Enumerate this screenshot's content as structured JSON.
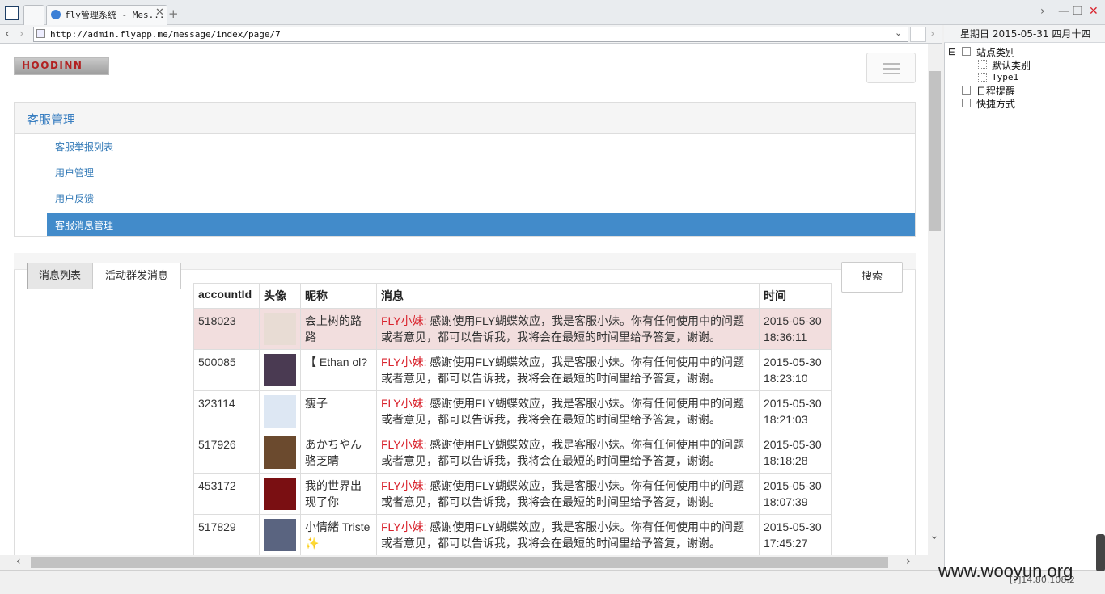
{
  "browser": {
    "tab_title": "fly管理系统 - Mes...",
    "new_tab": "+",
    "url": "http://admin.flyapp.me/message/index/page/7",
    "date": "星期日 2015-05-31 四月十四"
  },
  "side_tree": {
    "items": [
      {
        "label": "站点类别",
        "expand": "⊟"
      },
      {
        "label": "默认类别"
      },
      {
        "label": "Type1"
      },
      {
        "label": "日程提醒"
      },
      {
        "label": "快捷方式"
      }
    ]
  },
  "header": {
    "logo": "HOODINN"
  },
  "service_panel": {
    "title": "客服管理",
    "menu": [
      "客服举报列表",
      "用户管理",
      "用户反馈",
      "客服消息管理"
    ]
  },
  "messages": {
    "tabs": [
      "消息列表",
      "活动群发消息"
    ],
    "search_label": "搜索",
    "columns": [
      "accountId",
      "头像",
      "昵称",
      "消息",
      "时间"
    ],
    "sender": "FLY小妹:",
    "rows": [
      {
        "id": "518023",
        "nick": "会上树的路路",
        "text": " 感谢使用FLY蝴蝶效应，我是客服小妹。你有任何使用中的问题或者意见，都可以告诉我，我将会在最短的时间里给予答复，谢谢。",
        "time": "2015-05-30 18:36:11",
        "avatar_color": "#e8dcd4"
      },
      {
        "id": "500085",
        "nick": "【 Ethan ol?",
        "text": " 感谢使用FLY蝴蝶效应，我是客服小妹。你有任何使用中的问题或者意见，都可以告诉我，我将会在最短的时间里给予答复，谢谢。",
        "time": "2015-05-30 18:23:10",
        "avatar_color": "#4a3a52"
      },
      {
        "id": "323114",
        "nick": "瘦子",
        "text": " 感谢使用FLY蝴蝶效应，我是客服小妹。你有任何使用中的问题或者意见，都可以告诉我，我将会在最短的时间里给予答复，谢谢。",
        "time": "2015-05-30 18:21:03",
        "avatar_color": "#dde7f3"
      },
      {
        "id": "517926",
        "nick": "あかちやん骆芝晴",
        "text": " 感谢使用FLY蝴蝶效应，我是客服小妹。你有任何使用中的问题或者意见，都可以告诉我，我将会在最短的时间里给予答复，谢谢。",
        "time": "2015-05-30 18:18:28",
        "avatar_color": "#6b4a2e"
      },
      {
        "id": "453172",
        "nick": "我的世界出现了你",
        "text": " 感谢使用FLY蝴蝶效应，我是客服小妹。你有任何使用中的问题或者意见，都可以告诉我，我将会在最短的时间里给予答复，谢谢。",
        "time": "2015-05-30 18:07:39",
        "avatar_color": "#7a0f12"
      },
      {
        "id": "517829",
        "nick": "小情緒 Triste ✨",
        "text": " 感谢使用FLY蝴蝶效应，我是客服小妹。你有任何使用中的问题或者意见，都可以告诉我，我将会在最短的时间里给予答复，谢谢。",
        "time": "2015-05-30 17:45:27",
        "avatar_color": "#5a6480"
      }
    ]
  },
  "overlay": {
    "watermark": "www.wooyun.org",
    "ip": "[?]14.80.108.2"
  }
}
